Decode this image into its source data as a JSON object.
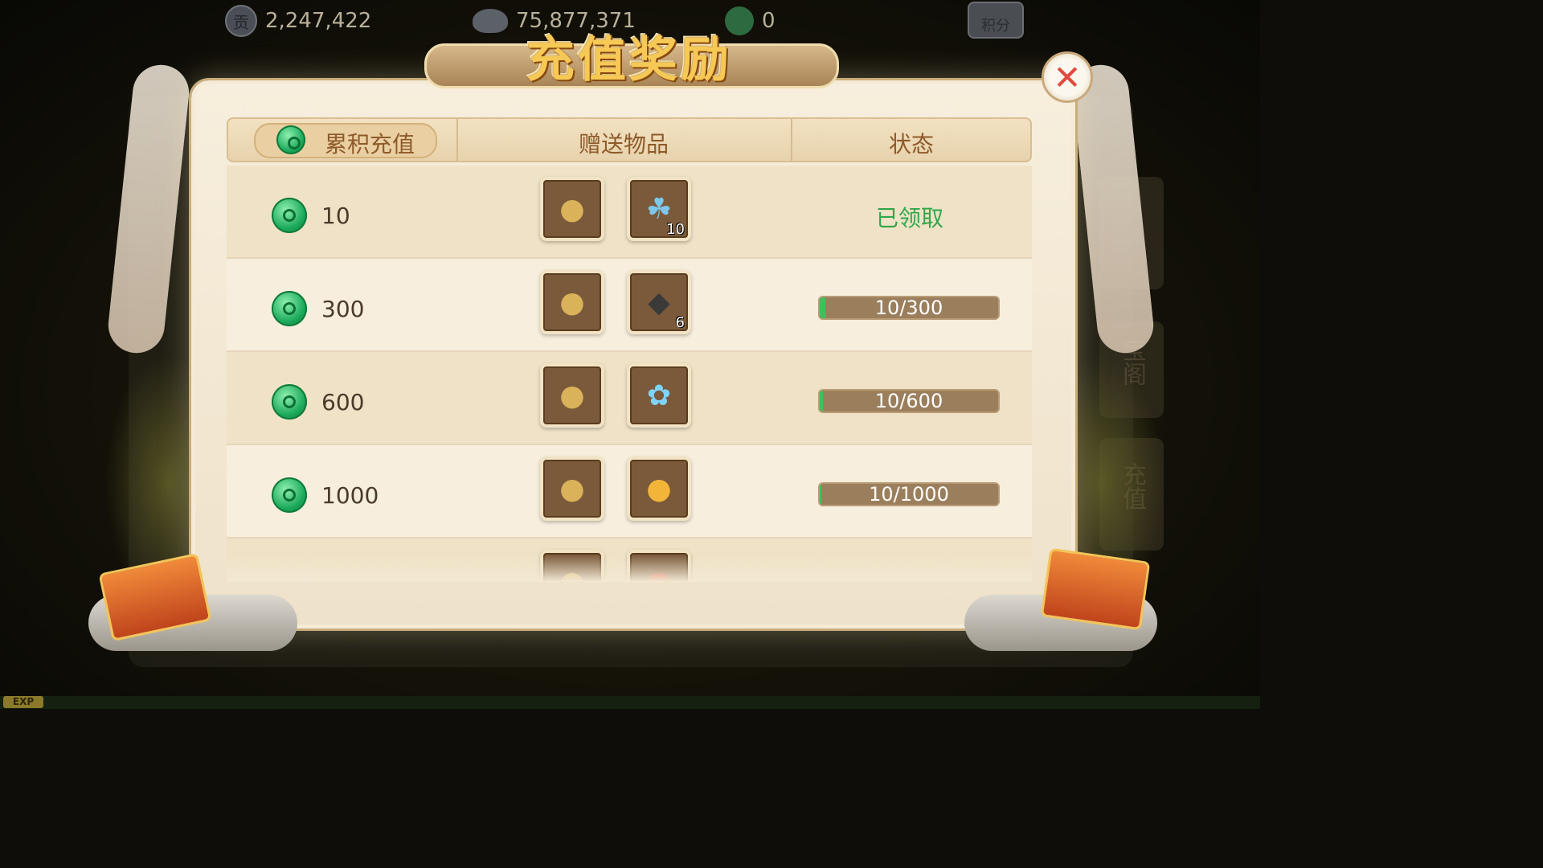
{
  "currency_bar": {
    "contribution_icon": "贡",
    "contribution_value": "2,247,422",
    "silver_value": "75,877,371",
    "jade_value": "0",
    "score_button_label": "积分"
  },
  "dialog": {
    "title": "充值奖励",
    "close_label": "✕",
    "columns": {
      "cumulative": "累积充值",
      "gifts": "赠送物品",
      "status": "状态"
    }
  },
  "side_menu": {
    "item_treasure": "宝阁",
    "item_recharge": "充值"
  },
  "exp_label": "EXP",
  "rows": [
    {
      "amount": "10",
      "items": [
        {
          "icon": "silver-bag-icon",
          "count": ""
        },
        {
          "icon": "vase-icon",
          "count": "10"
        }
      ],
      "status_text": "已领取",
      "claimed": true
    },
    {
      "amount": "300",
      "items": [
        {
          "icon": "silver-bag-icon",
          "count": ""
        },
        {
          "icon": "ore-icon",
          "count": "6"
        }
      ],
      "status_text": "10/300",
      "progress": 0.033,
      "claimed": false
    },
    {
      "amount": "600",
      "items": [
        {
          "icon": "silver-bag-icon",
          "count": ""
        },
        {
          "icon": "crystal-orb-icon",
          "count": ""
        }
      ],
      "status_text": "10/600",
      "progress": 0.017,
      "claimed": false
    },
    {
      "amount": "1000",
      "items": [
        {
          "icon": "silver-bag-icon",
          "count": ""
        },
        {
          "icon": "gold-bag-icon",
          "count": ""
        }
      ],
      "status_text": "10/1000",
      "progress": 0.01,
      "claimed": false
    }
  ],
  "colors": {
    "claimed_green": "#2ea84a",
    "progress_fill": "#39c35a",
    "header_text": "#8e5a2a",
    "title_gold": "#f6c956",
    "close_red": "#e04a40"
  }
}
